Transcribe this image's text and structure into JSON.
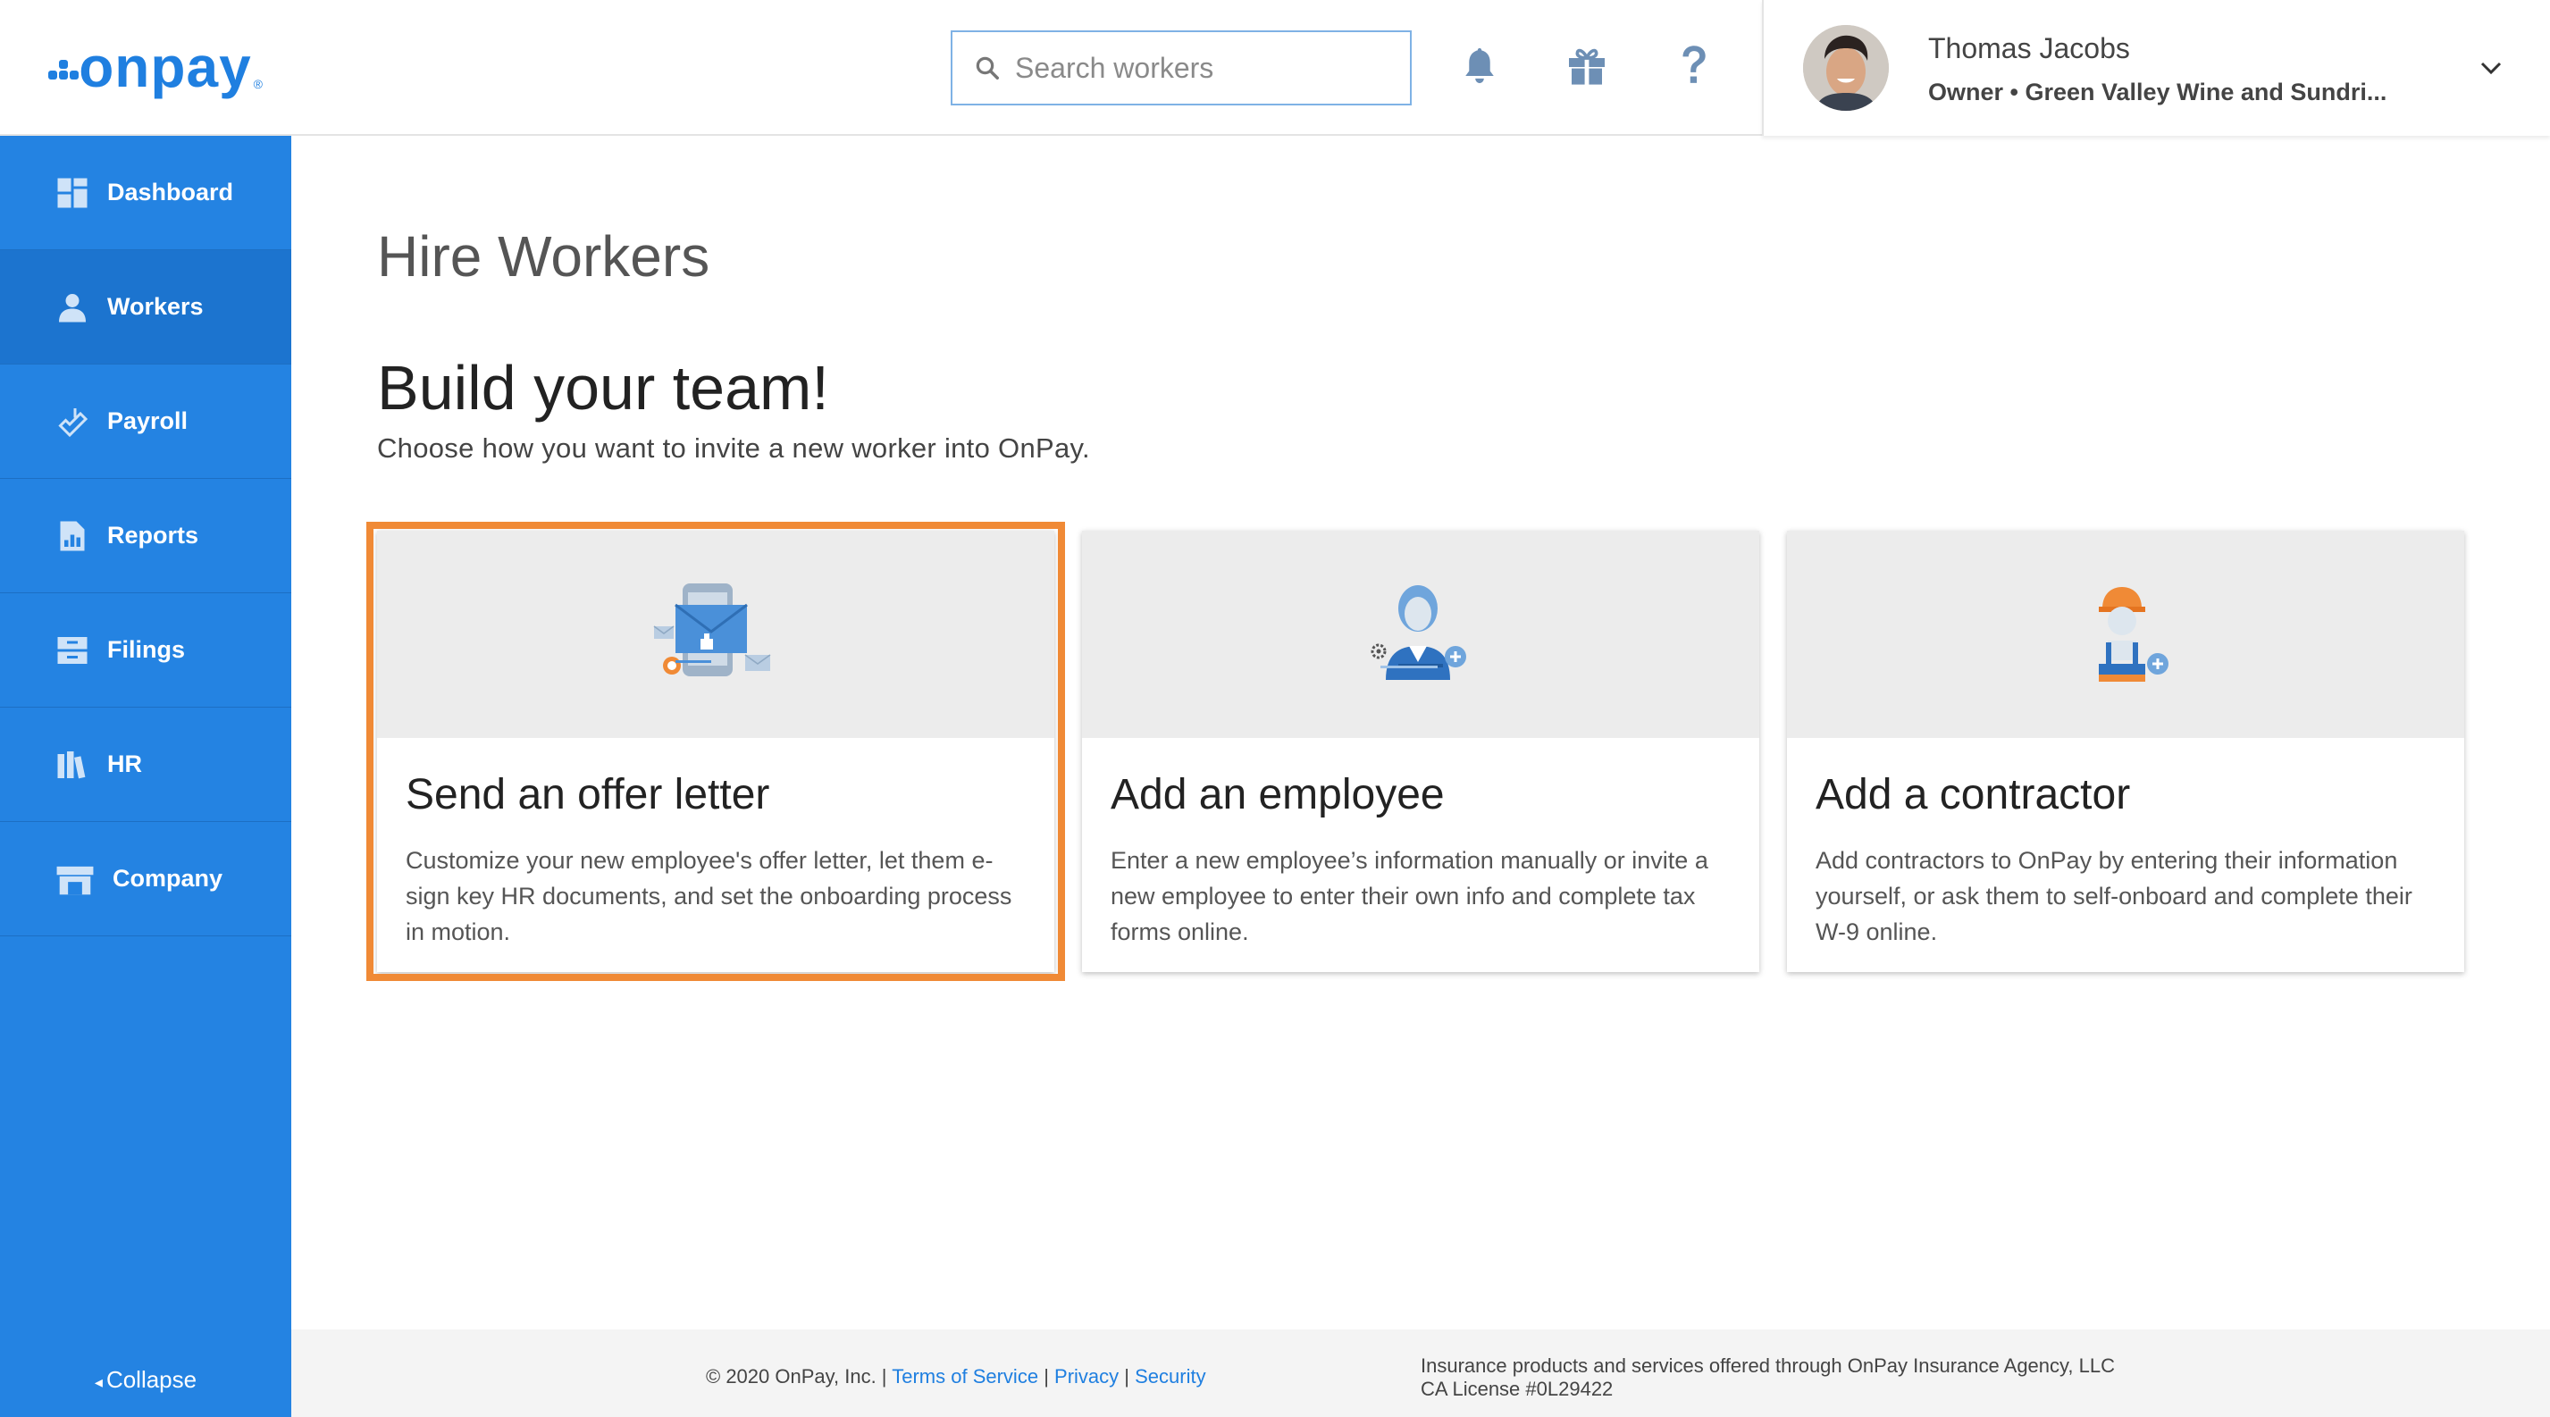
{
  "brand": {
    "name": "onpay",
    "color": "#1f7fe0",
    "reg_mark": "®"
  },
  "search": {
    "placeholder": "Search workers"
  },
  "header_icons": [
    "bell-icon",
    "gift-icon",
    "help-icon"
  ],
  "user": {
    "name": "Thomas Jacobs",
    "role": "Owner • Green Valley Wine and Sundri..."
  },
  "sidebar": {
    "color": "#2483e2",
    "items": [
      {
        "label": "Dashboard",
        "icon": "dashboard-icon",
        "active": false
      },
      {
        "label": "Workers",
        "icon": "workers-icon",
        "active": true
      },
      {
        "label": "Payroll",
        "icon": "payroll-icon",
        "active": false
      },
      {
        "label": "Reports",
        "icon": "reports-icon",
        "active": false
      },
      {
        "label": "Filings",
        "icon": "filings-icon",
        "active": false
      },
      {
        "label": "HR",
        "icon": "hr-icon",
        "active": false
      },
      {
        "label": "Company",
        "icon": "company-icon",
        "active": false
      }
    ],
    "collapse_label": "Collapse"
  },
  "main": {
    "title": "Hire Workers",
    "subtitle": "Build your team!",
    "description": "Choose how you want to invite a new worker into OnPay.",
    "highlight_color": "#f08a36",
    "cards": [
      {
        "title": "Send an offer letter",
        "description": "Customize your new employee's offer letter, let them e-sign key HR documents, and set the onboarding process in motion.",
        "icon": "offer-letter-icon"
      },
      {
        "title": "Add an employee",
        "description": "Enter a new employee’s information manually or invite a new employee to enter their own info and complete tax forms online.",
        "icon": "employee-icon"
      },
      {
        "title": "Add a contractor",
        "description": "Add contractors to OnPay by entering their information yourself, or ask them to self-onboard and complete their W-9 online.",
        "icon": "contractor-icon"
      }
    ]
  },
  "footer": {
    "copyright": "© 2020 OnPay, Inc. |",
    "links": [
      "Terms of Service",
      "Privacy",
      "Security"
    ],
    "separator": "|",
    "insurance_line1": "Insurance products and services offered through OnPay Insurance Agency, LLC",
    "insurance_line2": "CA License #0L29422"
  }
}
